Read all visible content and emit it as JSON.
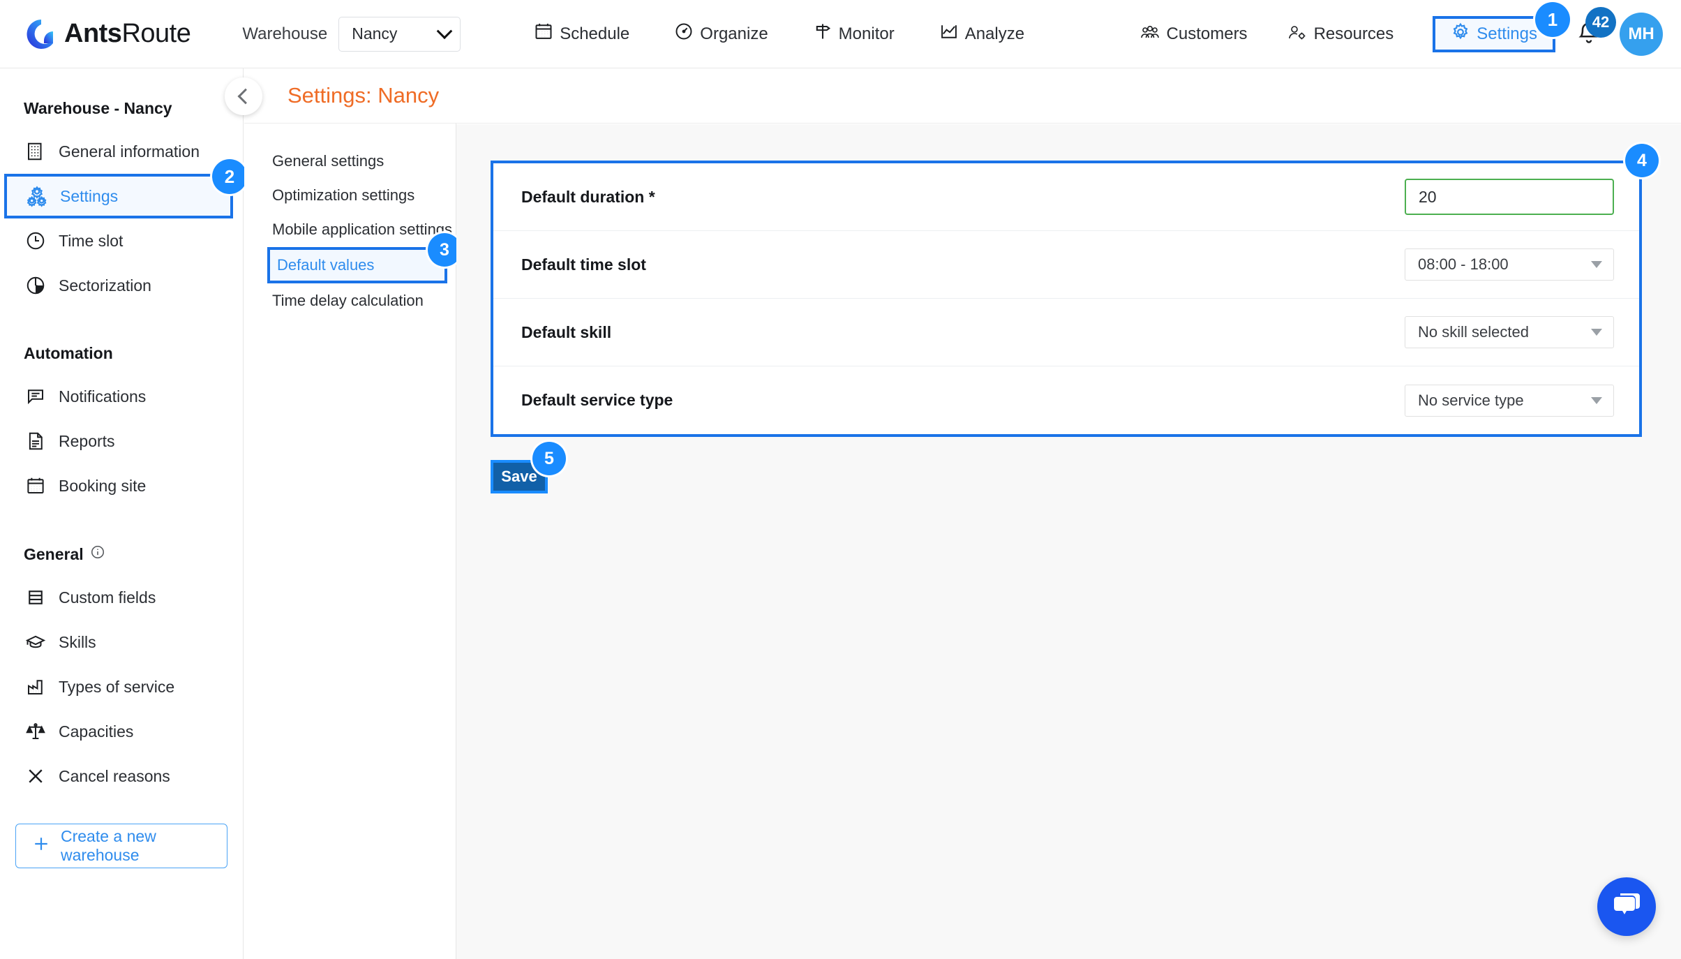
{
  "topbar": {
    "logo_bold": "Ants",
    "logo_light": "Route",
    "warehouse_label": "Warehouse",
    "warehouse_value": "Nancy",
    "nav_center": [
      {
        "label": "Schedule",
        "icon": "calendar-icon"
      },
      {
        "label": "Organize",
        "icon": "gauge-icon"
      },
      {
        "label": "Monitor",
        "icon": "signpost-icon"
      },
      {
        "label": "Analyze",
        "icon": "chart-icon"
      }
    ],
    "nav_right": [
      {
        "label": "Customers",
        "icon": "people-icon"
      },
      {
        "label": "Resources",
        "icon": "person-gear-icon"
      }
    ],
    "settings_label": "Settings",
    "settings_step": "1",
    "notification_count": "42",
    "avatar_initials": "MH"
  },
  "sidebar": {
    "section_warehouse": "Warehouse - Nancy",
    "warehouse_items": [
      {
        "label": "General information",
        "icon": "building-icon",
        "active": false
      },
      {
        "label": "Settings",
        "icon": "gears-icon",
        "active": true,
        "step": "2"
      },
      {
        "label": "Time slot",
        "icon": "clock-icon",
        "active": false
      },
      {
        "label": "Sectorization",
        "icon": "pie-chart-icon",
        "active": false
      }
    ],
    "section_automation": "Automation",
    "automation_items": [
      {
        "label": "Notifications",
        "icon": "message-icon"
      },
      {
        "label": "Reports",
        "icon": "document-icon"
      },
      {
        "label": "Booking site",
        "icon": "calendar-icon"
      }
    ],
    "section_general": "General",
    "general_items": [
      {
        "label": "Custom fields",
        "icon": "rows-icon"
      },
      {
        "label": "Skills",
        "icon": "graduation-cap-icon"
      },
      {
        "label": "Types of service",
        "icon": "factory-icon"
      },
      {
        "label": "Capacities",
        "icon": "scales-icon"
      },
      {
        "label": "Cancel reasons",
        "icon": "close-x-icon"
      }
    ],
    "create_warehouse_label": "Create a new warehouse"
  },
  "subnav": {
    "items": [
      {
        "label": "General settings",
        "active": false
      },
      {
        "label": "Optimization settings",
        "active": false
      },
      {
        "label": "Mobile application settings",
        "active": false
      },
      {
        "label": "Default values",
        "active": true,
        "step": "3"
      },
      {
        "label": "Time delay calculation",
        "active": false
      }
    ]
  },
  "page": {
    "title": "Settings: Nancy"
  },
  "form": {
    "step": "4",
    "rows": [
      {
        "label": "Default duration *",
        "value": "20",
        "type": "text"
      },
      {
        "label": "Default time slot",
        "value": "08:00 - 18:00",
        "type": "select"
      },
      {
        "label": "Default skill",
        "value": "No skill selected",
        "type": "select"
      },
      {
        "label": "Default service type",
        "value": "No service type",
        "type": "select"
      }
    ],
    "save_label": "Save",
    "save_step": "5"
  },
  "chat": {
    "icon": "chat-bubble-icon"
  },
  "colors": {
    "accent_blue": "#1a73e8",
    "badge_blue": "#1a8cff",
    "title_orange": "#ef6c26",
    "input_green": "#4caf50",
    "save_blue": "#1160a8",
    "chat_blue": "#1a56f0"
  }
}
